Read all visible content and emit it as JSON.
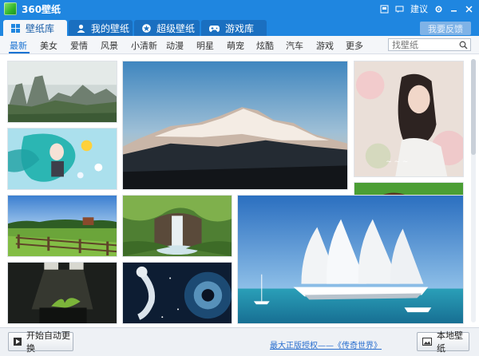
{
  "window": {
    "title": "360壁纸",
    "controls": {
      "feedback_label": "建议"
    }
  },
  "tabs": [
    {
      "label": "壁纸库",
      "icon": "grid-icon",
      "active": true
    },
    {
      "label": "我的壁纸",
      "icon": "user-icon",
      "active": false
    },
    {
      "label": "超级壁纸",
      "icon": "star-icon",
      "active": false
    },
    {
      "label": "游戏库",
      "icon": "gamepad-icon",
      "active": false
    }
  ],
  "feedback_button": {
    "label": "我要反馈"
  },
  "categories": [
    {
      "label": "最新",
      "active": true
    },
    {
      "label": "美女"
    },
    {
      "label": "爱情"
    },
    {
      "label": "风景"
    },
    {
      "label": "小清新"
    },
    {
      "label": "动漫"
    },
    {
      "label": "明星"
    },
    {
      "label": "萌宠"
    },
    {
      "label": "炫酷"
    },
    {
      "label": "汽车"
    },
    {
      "label": "游戏"
    },
    {
      "label": "更多"
    }
  ],
  "search": {
    "placeholder": "找壁纸"
  },
  "thumbnails": [
    {
      "subject": "mountain-rocks-landscape"
    },
    {
      "subject": "snow-mountain-peaks-sunset"
    },
    {
      "subject": "girl-in-flowers"
    },
    {
      "subject": "anime-girl-teal-hair"
    },
    {
      "subject": "girl-lying-on-grass"
    },
    {
      "subject": "farm-field-fence"
    },
    {
      "subject": "waterfall-forest"
    },
    {
      "subject": "sailing-yacht-sea"
    },
    {
      "subject": "plant-seedling-dark"
    },
    {
      "subject": "astronaut-space-vortex"
    }
  ],
  "footer": {
    "auto_change_label": "开始自动更换",
    "copyright_text": "最大正版授权——《传奇世界》",
    "local_wallpaper_label": "本地壁纸"
  },
  "colors": {
    "titlebar": "#1f86e0",
    "accent": "#1a73d2"
  }
}
